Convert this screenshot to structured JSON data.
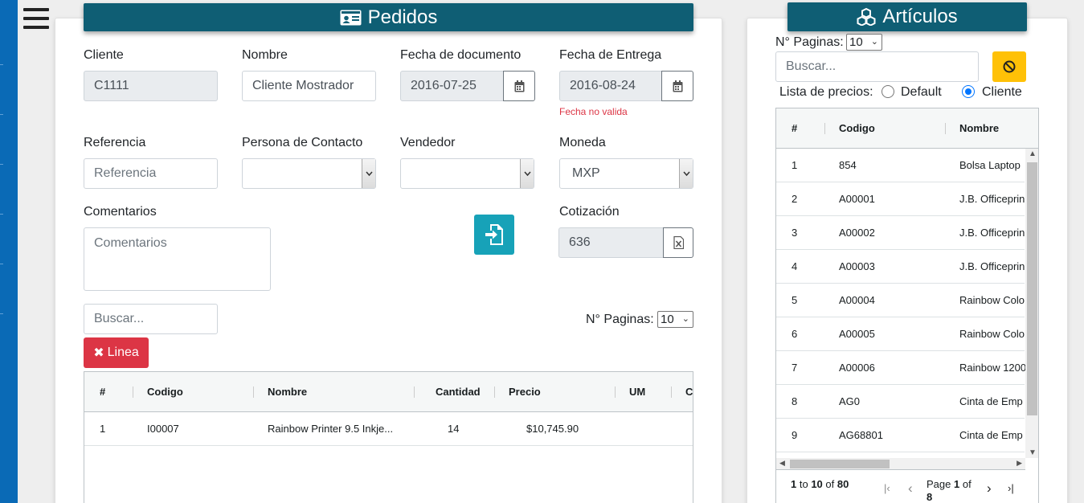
{
  "pedidos": {
    "title": "Pedidos",
    "icon": "id-card-icon",
    "fields": {
      "cliente": {
        "label": "Cliente",
        "value": "C1111"
      },
      "nombre": {
        "label": "Nombre",
        "value": "Cliente Mostrador"
      },
      "fecha_documento": {
        "label": "Fecha de documento",
        "value": "2016-07-25"
      },
      "fecha_entrega": {
        "label": "Fecha de Entrega",
        "value": "2016-08-24",
        "error": "Fecha no valida"
      },
      "referencia": {
        "label": "Referencia",
        "placeholder": "Referencia"
      },
      "persona_contacto": {
        "label": "Persona de Contacto",
        "value": ""
      },
      "vendedor": {
        "label": "Vendedor",
        "value": ""
      },
      "moneda": {
        "label": "Moneda",
        "value": "MXP"
      },
      "comentarios": {
        "label": "Comentarios",
        "placeholder": "Comentarios"
      },
      "cotizacion": {
        "label": "Cotización",
        "value": "636"
      }
    },
    "search_placeholder": "Buscar...",
    "paginas_label": "N° Paginas:",
    "paginas_value": "10",
    "linea_button": "Linea",
    "grid": {
      "columns": [
        "#",
        "Codigo",
        "Nombre",
        "Cantidad",
        "Precio",
        "UM",
        "C"
      ],
      "rows": [
        {
          "num": "1",
          "codigo": "I00007",
          "nombre": "Rainbow Printer 9.5 Inkje...",
          "cantidad": "14",
          "precio": "$10,745.90"
        }
      ]
    }
  },
  "articulos": {
    "title": "Artículos",
    "icon": "cubes-icon",
    "paginas_label": "N° Paginas:",
    "paginas_value": "10",
    "search_placeholder": "Buscar...",
    "lista_label": "Lista de precios:",
    "radio_default": "Default",
    "radio_cliente": "Cliente",
    "selected_price_list": "Cliente",
    "grid": {
      "columns": [
        "#",
        "Codigo",
        "Nombre"
      ],
      "rows": [
        {
          "num": "1",
          "codigo": "854",
          "nombre": "Bolsa Laptop"
        },
        {
          "num": "2",
          "codigo": "A00001",
          "nombre": "J.B. Officeprin"
        },
        {
          "num": "3",
          "codigo": "A00002",
          "nombre": "J.B. Officeprin"
        },
        {
          "num": "4",
          "codigo": "A00003",
          "nombre": "J.B. Officeprin"
        },
        {
          "num": "5",
          "codigo": "A00004",
          "nombre": "Rainbow Colo"
        },
        {
          "num": "6",
          "codigo": "A00005",
          "nombre": "Rainbow Colo"
        },
        {
          "num": "7",
          "codigo": "A00006",
          "nombre": "Rainbow 1200"
        },
        {
          "num": "8",
          "codigo": "AG0",
          "nombre": "Cinta de Emp"
        },
        {
          "num": "9",
          "codigo": "AG68801",
          "nombre": "Cinta de Emp"
        }
      ]
    },
    "pager": {
      "range_from": "1",
      "to_word": "to",
      "range_to": "10",
      "of_word": "of",
      "total": "80",
      "page_word": "Page",
      "page": "1",
      "page_of": "of",
      "pages": "8"
    }
  },
  "colors": {
    "header": "#0f5e74",
    "danger": "#dc3545",
    "info": "#17a2b8",
    "warning": "#ffc107",
    "sidebar": "#0a6ab6"
  }
}
